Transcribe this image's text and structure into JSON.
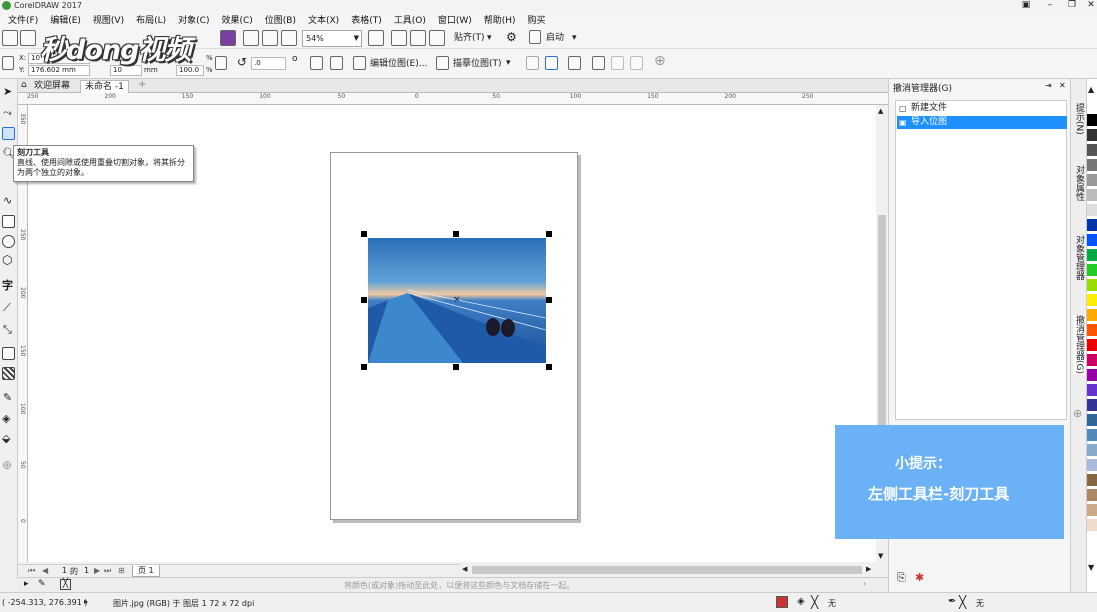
{
  "app": {
    "title": "CorelDRAW 2017"
  },
  "menu": [
    "文件(F)",
    "编辑(E)",
    "视图(V)",
    "布局(L)",
    "对象(C)",
    "效果(C)",
    "位图(B)",
    "文本(X)",
    "表格(T)",
    "工具(O)",
    "窗口(W)",
    "帮助(H)",
    "购买"
  ],
  "toolbar": {
    "zoom": "54%",
    "snap": "贴齐(T)",
    "launch": "启动"
  },
  "props": {
    "x_value": "10",
    "y_value": "176.602 mm",
    "w_value": "10",
    "w_unit": "mm",
    "scale": "100.0",
    "pct": "%",
    "pct2": "%",
    "angle": ".0",
    "deg": "o",
    "edit_bitmap": "编辑位图(E)...",
    "trace_bitmap": "描摹位图(T)"
  },
  "logo": {
    "text": "秒dong视频"
  },
  "tabs": [
    {
      "label": "欢迎屏幕"
    },
    {
      "label": "未命名 -1"
    }
  ],
  "ruler": {
    "h": [
      "250",
      "200",
      "150",
      "100",
      "50",
      "0",
      "50",
      "100",
      "150",
      "200",
      "250",
      "300",
      "350",
      "400",
      "450"
    ],
    "v": [
      "350",
      "300",
      "250",
      "200",
      "150",
      "100",
      "50",
      "0"
    ]
  },
  "tooltip": {
    "title": "刻刀工具",
    "desc": "直线、使用间隙或使用重叠切割对象，将其拆分为两个独立的对象。"
  },
  "pagenav": {
    "current": "1",
    "of": "的",
    "total": "1",
    "page_tab": "页 1"
  },
  "colorbar": {
    "hint": "将颜色(或对象)拖动至此处，以便将这些颜色与文档存储在一起。"
  },
  "status": {
    "coords": "( -254.313, 276.391 )",
    "object_info": "图片.jpg (RGB) 于 图层 1 72 x 72 dpi",
    "fill": "无",
    "outline": "无"
  },
  "panel": {
    "title": "撤消管理器(G)",
    "items": [
      {
        "label": "新建文件"
      },
      {
        "label": "导入位图"
      }
    ]
  },
  "sidetabs": [
    "提示(N)",
    "对象属性",
    "对象管理器",
    "撤消管理器(G)"
  ],
  "tip": {
    "line1": "小提示：",
    "line2": "左侧工具栏-刻刀工具"
  },
  "palette_colors": [
    "#ffffff",
    "#000000",
    "#333333",
    "#555555",
    "#777777",
    "#999999",
    "#bbbbbb",
    "#dddddd",
    "#0033aa",
    "#0055ff",
    "#00aa44",
    "#22cc22",
    "#99dd00",
    "#ffee00",
    "#ffaa00",
    "#ff5500",
    "#ee0000",
    "#cc0066",
    "#9900aa",
    "#6633cc",
    "#333399",
    "#336699",
    "#5588bb",
    "#88aacc",
    "#aabbdd",
    "#886644",
    "#aa8866",
    "#ccaa88",
    "#eeddcc"
  ]
}
